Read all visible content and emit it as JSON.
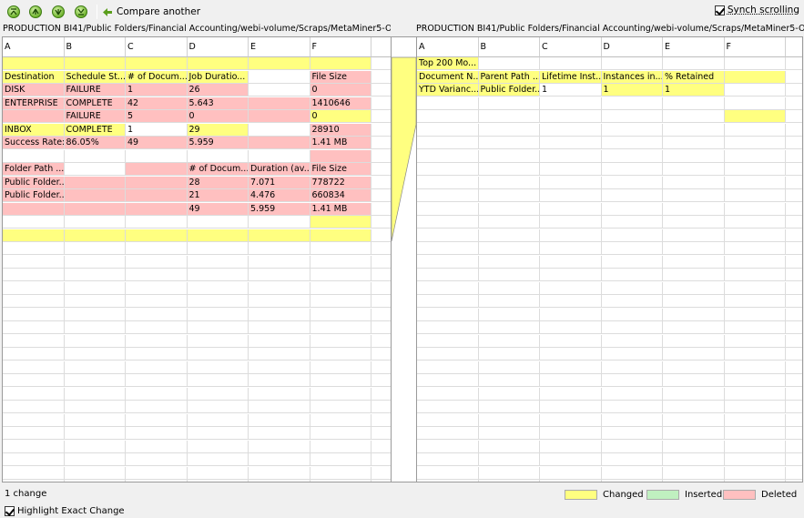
{
  "toolbar": {
    "nav_buttons": [
      "first-change-icon",
      "previous-change-icon",
      "next-change-icon",
      "last-change-icon"
    ],
    "compare_label": "Compare another",
    "synch_label": "Synch scrolling",
    "synch_checked": true
  },
  "left": {
    "path": "PRODUCTION BI41/Public Folders/Financial Accounting/webi-volume/Scraps/MetaMiner5-OLD/M...",
    "columns": [
      "A",
      "B",
      "C",
      "D",
      "E",
      "F",
      ""
    ],
    "rows": [
      {
        "cells": [
          "",
          "",
          "",
          "",
          "",
          "",
          ""
        ],
        "styles": [
          "y",
          "y",
          "y",
          "y",
          "y",
          "y",
          ""
        ]
      },
      {
        "cells": [
          "Destination",
          "Schedule St...",
          "# of Docum...",
          "Job Duratio...",
          "",
          "File Size",
          ""
        ],
        "styles": [
          "y",
          "y",
          "y",
          "y",
          "",
          "p",
          ""
        ]
      },
      {
        "cells": [
          "DISK",
          "FAILURE",
          "1",
          "26",
          "",
          "0",
          ""
        ],
        "styles": [
          "p",
          "p",
          "p",
          "p",
          "",
          "p",
          ""
        ]
      },
      {
        "cells": [
          "ENTERPRISE",
          "COMPLETE",
          "42",
          "5.643",
          "",
          "1410646",
          ""
        ],
        "styles": [
          "p",
          "p",
          "p",
          "p",
          "p",
          "p",
          ""
        ]
      },
      {
        "cells": [
          "",
          "FAILURE",
          "5",
          "0",
          "",
          "0",
          ""
        ],
        "styles": [
          "p",
          "p",
          "p",
          "p",
          "p",
          "y",
          ""
        ]
      },
      {
        "cells": [
          "INBOX",
          "COMPLETE",
          "1",
          "29",
          "",
          "28910",
          ""
        ],
        "styles": [
          "y",
          "y",
          "",
          "y",
          "",
          "p",
          ""
        ]
      },
      {
        "cells": [
          "Success Rate:",
          "86.05%",
          "49",
          "5.959",
          "",
          "1.41 MB",
          ""
        ],
        "styles": [
          "p",
          "p",
          "p",
          "p",
          "p",
          "p",
          ""
        ]
      },
      {
        "cells": [
          "",
          "",
          "",
          "",
          "",
          "",
          ""
        ],
        "styles": [
          "",
          "",
          "",
          "",
          "",
          "p",
          ""
        ]
      },
      {
        "cells": [
          "Folder Path ...",
          "",
          "",
          "# of Docum...",
          "Duration (av...",
          "File Size",
          ""
        ],
        "styles": [
          "p",
          "",
          "p",
          "p",
          "p",
          "p",
          ""
        ]
      },
      {
        "cells": [
          "Public Folder...",
          "",
          "",
          "28",
          "7.071",
          "778722",
          ""
        ],
        "styles": [
          "p",
          "p",
          "p",
          "p",
          "p",
          "p",
          ""
        ]
      },
      {
        "cells": [
          "Public Folder...",
          "",
          "",
          "21",
          "4.476",
          "660834",
          ""
        ],
        "styles": [
          "p",
          "p",
          "p",
          "p",
          "p",
          "p",
          ""
        ]
      },
      {
        "cells": [
          "",
          "",
          "",
          "49",
          "5.959",
          "1.41 MB",
          ""
        ],
        "styles": [
          "p",
          "p",
          "p",
          "p",
          "p",
          "p",
          ""
        ]
      },
      {
        "cells": [
          "",
          "",
          "",
          "",
          "",
          "",
          ""
        ],
        "styles": [
          "",
          "",
          "",
          "",
          "",
          "y",
          ""
        ]
      },
      {
        "cells": [
          "",
          "",
          "",
          "",
          "",
          "",
          ""
        ],
        "styles": [
          "y",
          "y",
          "y",
          "y",
          "y",
          "y",
          ""
        ]
      }
    ]
  },
  "right": {
    "path": "PRODUCTION BI41/Public Folders/Financial Accounting/webi-volume/Scraps/MetaMiner5-OLD/M...",
    "columns": [
      "A",
      "B",
      "C",
      "D",
      "E",
      "F",
      ""
    ],
    "rows": [
      {
        "cells": [
          "Top 200 Mo...",
          "",
          "",
          "",
          "",
          "",
          ""
        ],
        "styles": [
          "y",
          "",
          "",
          "",
          "",
          "",
          ""
        ]
      },
      {
        "cells": [
          "Document N...",
          "Parent Path ...",
          "Lifetime Inst...",
          "Instances in...",
          "% Retained",
          "",
          ""
        ],
        "styles": [
          "y",
          "y",
          "y",
          "y",
          "y",
          "y",
          ""
        ]
      },
      {
        "cells": [
          "YTD Varianc...",
          "Public Folder...",
          "1",
          "1",
          "1",
          "",
          ""
        ],
        "styles": [
          "y",
          "y",
          "",
          "y",
          "y",
          "",
          ""
        ]
      },
      {
        "cells": [
          "",
          "",
          "",
          "",
          "",
          "",
          ""
        ],
        "styles": [
          "",
          "",
          "",
          "",
          "",
          "",
          ""
        ]
      },
      {
        "cells": [
          "",
          "",
          "",
          "",
          "",
          "",
          ""
        ],
        "styles": [
          "",
          "",
          "",
          "",
          "",
          "y",
          ""
        ]
      }
    ]
  },
  "status": {
    "changes": "1 change",
    "legend": [
      {
        "label": "Changed",
        "color": "#ffff80"
      },
      {
        "label": "Inserted",
        "color": "#c0f0c0"
      },
      {
        "label": "Deleted",
        "color": "#ffc0c0"
      }
    ],
    "highlight_label": "Highlight Exact Change",
    "highlight_checked": true
  }
}
